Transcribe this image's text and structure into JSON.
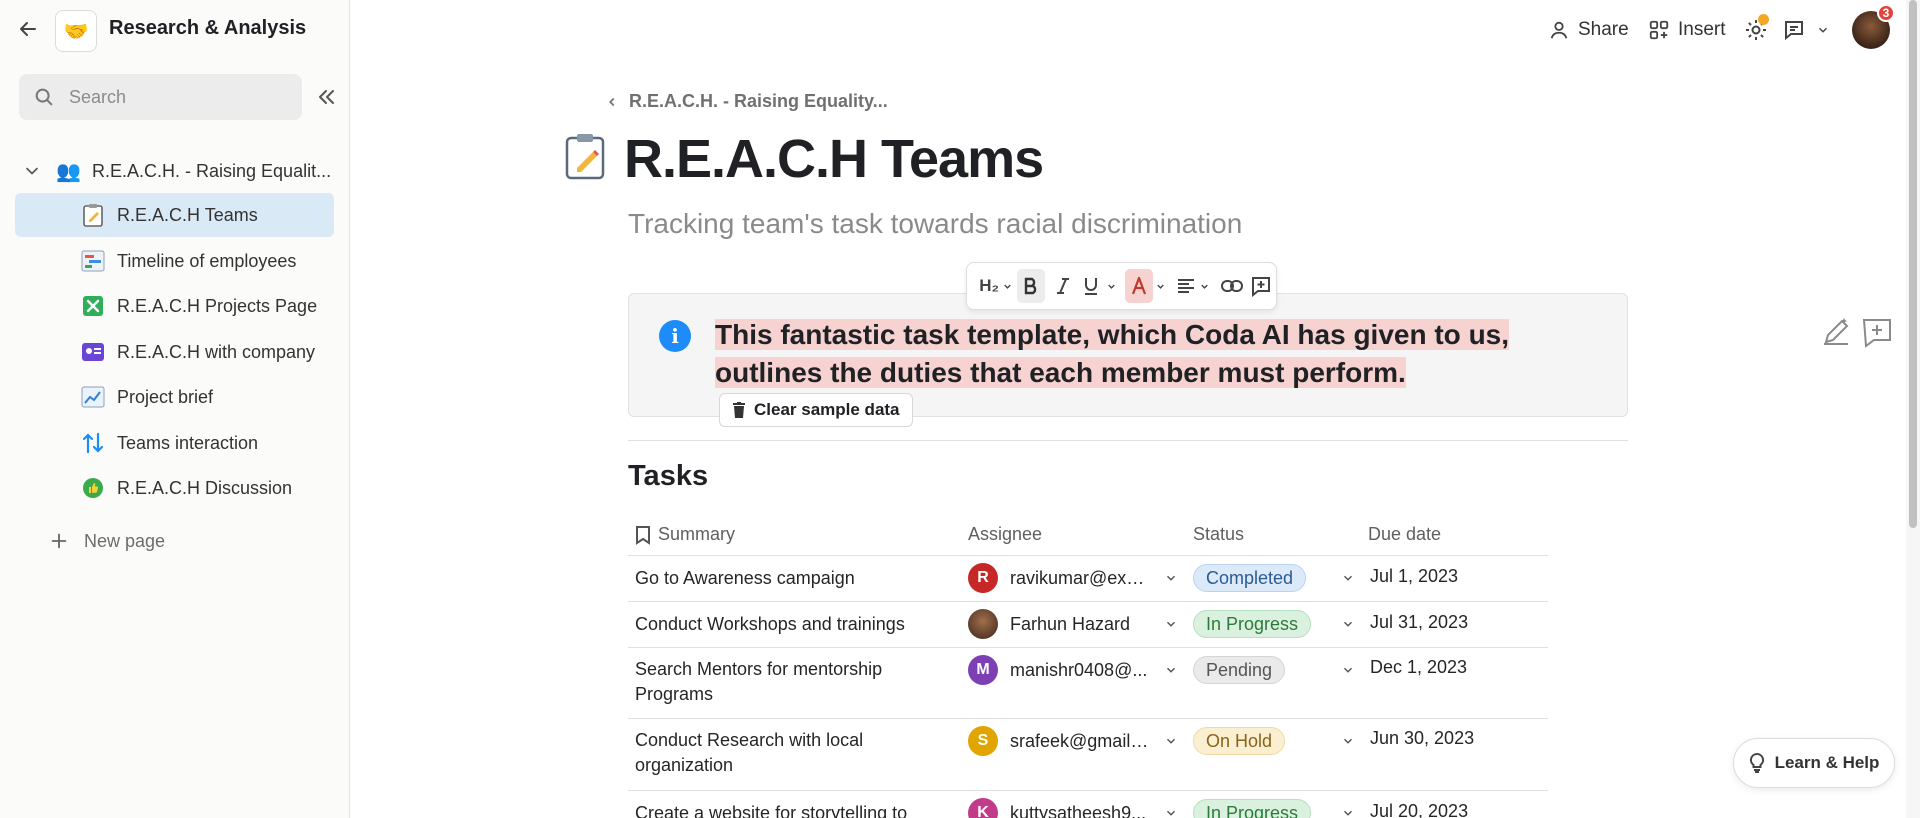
{
  "doc": {
    "title": "Research & Analysis",
    "logo_icon": "handshake-emoji"
  },
  "search": {
    "placeholder": "Search"
  },
  "sidebar": {
    "root": {
      "label": "R.E.A.C.H. - Raising Equalit...",
      "icon": "people-emoji"
    },
    "items": [
      {
        "label": "R.E.A.C.H Teams",
        "icon": "clipboard-pencil-icon",
        "active": true
      },
      {
        "label": "Timeline of employees",
        "icon": "timeline-icon",
        "active": false
      },
      {
        "label": "R.E.A.C.H Projects Page",
        "icon": "projects-grid-icon",
        "active": false
      },
      {
        "label": "R.E.A.C.H with company",
        "icon": "id-card-icon",
        "active": false
      },
      {
        "label": "Project brief",
        "icon": "chart-icon",
        "active": false
      },
      {
        "label": "Teams interaction",
        "icon": "sort-arrows-icon",
        "active": false
      },
      {
        "label": "R.E.A.C.H Discussion",
        "icon": "thumbs-up-icon",
        "active": false
      }
    ],
    "new_page": "New page"
  },
  "topbar": {
    "share": "Share",
    "insert": "Insert",
    "notification_count": "3"
  },
  "page": {
    "breadcrumb": "R.E.A.C.H. - Raising Equality...",
    "title": "R.E.A.C.H Teams",
    "subtitle": "Tracking team's task towards racial discrimination"
  },
  "toolbar": {
    "heading": "H₂"
  },
  "callout": {
    "text": "This fantastic task template, which Coda AI has given to us, outlines the duties that each member must perform.",
    "button": "Clear sample data"
  },
  "tasks": {
    "title": "Tasks",
    "columns": {
      "summary": "Summary",
      "assignee": "Assignee",
      "status": "Status",
      "due": "Due date"
    },
    "rows": [
      {
        "summary": "Go to Awareness campaign",
        "assignee": "ravikumar@exa...",
        "initial": "R",
        "color": "#c62828",
        "status": "Completed",
        "status_kind": "completed",
        "due": "Jul 1, 2023"
      },
      {
        "summary": "Conduct Workshops and trainings",
        "assignee": "Farhun Hazard",
        "initial": "",
        "color": "#5a3a2a",
        "status": "In Progress",
        "status_kind": "progress",
        "due": "Jul 31, 2023"
      },
      {
        "summary": "Search Mentors for mentorship Programs",
        "assignee": "manishr0408@...",
        "initial": "M",
        "color": "#7e3fb5",
        "status": "Pending",
        "status_kind": "pending",
        "due": "Dec 1, 2023"
      },
      {
        "summary": "Conduct Research with local organization",
        "assignee": "srafeek@gmail....",
        "initial": "S",
        "color": "#e0a500",
        "status": "On Hold",
        "status_kind": "hold",
        "due": "Jun 30, 2023"
      },
      {
        "summary": "Create a website for storytelling to",
        "assignee": "kuttysatheesh9...",
        "initial": "K",
        "color": "#c23a8a",
        "status": "In Progress",
        "status_kind": "progress",
        "due": "Jul 20, 2023"
      }
    ]
  },
  "learn_help": "Learn & Help"
}
